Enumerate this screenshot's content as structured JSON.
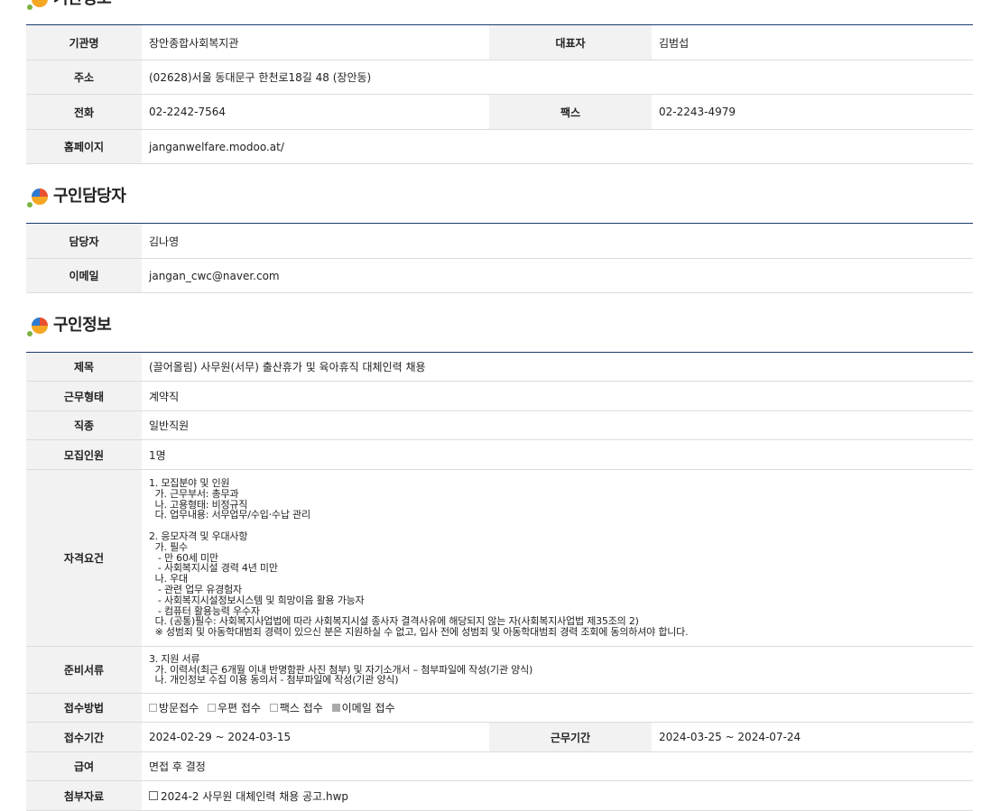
{
  "sections": {
    "org": {
      "title": "기관정보",
      "labels": {
        "name": "기관명",
        "rep": "대표자",
        "address": "주소",
        "phone": "전화",
        "fax": "팩스",
        "homepage": "홈페이지"
      },
      "values": {
        "name": "장안종합사회복지관",
        "rep": "김범섭",
        "address": "(02628)서울 동대문구 한천로18길 48 (장안동)",
        "phone": "02-2242-7564",
        "fax": "02-2243-4979",
        "homepage": "janganwelfare.modoo.at/"
      }
    },
    "contact": {
      "title": "구인담당자",
      "labels": {
        "person": "담당자",
        "email": "이메일"
      },
      "values": {
        "person": "김나영",
        "email": "jangan_cwc@naver.com"
      }
    },
    "job": {
      "title": "구인정보",
      "labels": {
        "subject": "제목",
        "employment": "근무형태",
        "occupation": "직종",
        "headcount": "모집인원",
        "qualifications": "자격요건",
        "documents": "준비서류",
        "method": "접수방법",
        "period": "접수기간",
        "work_period": "근무기간",
        "salary": "급여",
        "attachment": "첨부자료"
      },
      "values": {
        "subject": "(끌어올림) 사무원(서무) 출산휴가 및 육아휴직 대체인력 채용",
        "employment": "계약직",
        "occupation": "일반직원",
        "headcount": "1명",
        "qualifications": "1. 모집분야 및 인원\n  가. 근무부서: 총무과\n  나. 고용형태: 비정규직\n  다. 업무내용: 서무업무/수입·수납 관리\n\n2. 응모자격 및 우대사항\n  가. 필수\n   - 만 60세 미만\n   - 사회복지시설 경력 4년 미만\n  나. 우대\n   - 관련 업무 유경험자\n   - 사회복지시설정보시스템 및 희망이음 활용 가능자\n   - 컴퓨터 활용능력 우수자\n  다. (공통)필수: 사회복지사업법에 따라 사회복지시설 종사자 결격사유에 해당되지 않는 자(사회복지사업법 제35조의 2)\n  ※ 성범죄 및 아동학대범죄 경력이 있으신 분은 지원하실 수 없고, 입사 전에 성범죄 및 아동학대범죄 경력 조회에 동의하셔야 합니다.",
        "documents": "3. 지원 서류\n  가. 이력서(최근 6개월 이내 반명함판 사진 첨부) 및 자기소개서 – 첨부파일에 작성(기관 양식)\n  나. 개인정보 수집 이용 동의서 - 첨부파일에 작성(기관 양식)",
        "method_options": [
          {
            "label": "방문접수",
            "checked": false
          },
          {
            "label": "우편 접수",
            "checked": false
          },
          {
            "label": "팩스 접수",
            "checked": false
          },
          {
            "label": "이메일 접수",
            "checked": true
          }
        ],
        "period": "2024-02-29 ~ 2024-03-15",
        "work_period": "2024-03-25 ~ 2024-07-24",
        "salary": "면접 후 결정",
        "attachment": "2024-2 사무원 대체인력 채용 공고.hwp"
      }
    }
  },
  "colors": {
    "header_line": "#1b3b6f",
    "label_bg": "#f2f2f2",
    "icon_orange": "#f5a623",
    "icon_blue": "#2b7bd6",
    "icon_red": "#e94f35",
    "icon_green": "#7cb342"
  }
}
